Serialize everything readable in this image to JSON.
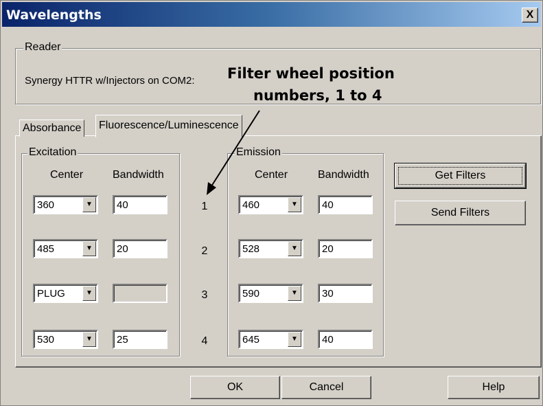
{
  "window": {
    "title": "Wavelengths",
    "close_label": "X"
  },
  "reader": {
    "group_label": "Reader",
    "text": "Synergy HTTR w/Injectors on COM2:"
  },
  "annotation": {
    "line1": "Filter wheel position",
    "line2": "numbers, 1 to 4"
  },
  "tabs": [
    {
      "label": "Absorbance",
      "active": false
    },
    {
      "label": "Fluorescence/Luminescence",
      "active": true
    }
  ],
  "excitation": {
    "group_label": "Excitation",
    "center_header": "Center",
    "bandwidth_header": "Bandwidth",
    "rows": [
      {
        "center": "360",
        "bandwidth": "40"
      },
      {
        "center": "485",
        "bandwidth": "20"
      },
      {
        "center": "PLUG",
        "bandwidth": ""
      },
      {
        "center": "530",
        "bandwidth": "25"
      }
    ]
  },
  "positions": [
    "1",
    "2",
    "3",
    "4"
  ],
  "emission": {
    "group_label": "Emission",
    "center_header": "Center",
    "bandwidth_header": "Bandwidth",
    "rows": [
      {
        "center": "460",
        "bandwidth": "40"
      },
      {
        "center": "528",
        "bandwidth": "20"
      },
      {
        "center": "590",
        "bandwidth": "30"
      },
      {
        "center": "645",
        "bandwidth": "40"
      }
    ]
  },
  "buttons": {
    "get_filters": "Get Filters",
    "send_filters": "Send Filters",
    "ok": "OK",
    "cancel": "Cancel",
    "help": "Help"
  },
  "colors": {
    "face": "#d4d0c8",
    "title_start": "#0a246a",
    "title_end": "#a6caf0"
  },
  "icons": {
    "dropdown": "chevron-down-icon",
    "close": "close-icon",
    "annotation_arrow": "arrow-icon"
  }
}
